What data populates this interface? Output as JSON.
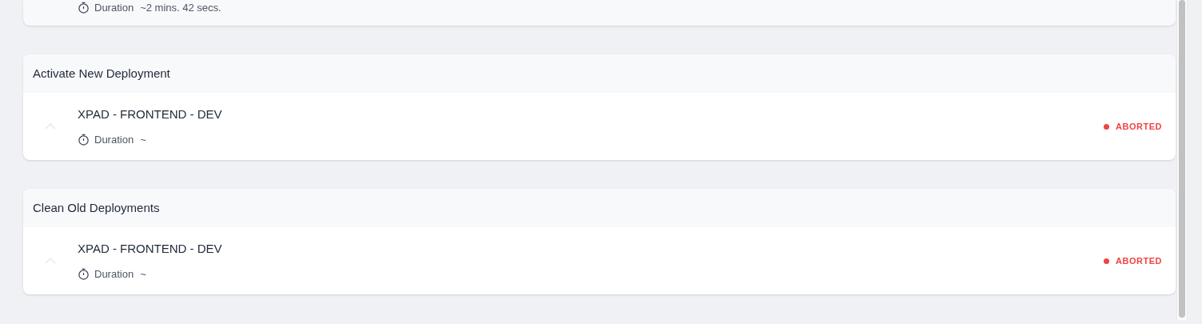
{
  "previous_step": {
    "duration_label": "Duration",
    "duration_value": "~2 mins. 42 secs."
  },
  "steps": [
    {
      "title": "Activate New Deployment",
      "job": {
        "name": "XPAD - FRONTEND - DEV",
        "duration_label": "Duration",
        "duration_value": "~",
        "status": "ABORTED",
        "color": "#ef4444"
      }
    },
    {
      "title": "Clean Old Deployments",
      "job": {
        "name": "XPAD - FRONTEND - DEV",
        "duration_label": "Duration",
        "duration_value": "~",
        "status": "ABORTED",
        "color": "#ef4444"
      }
    }
  ]
}
